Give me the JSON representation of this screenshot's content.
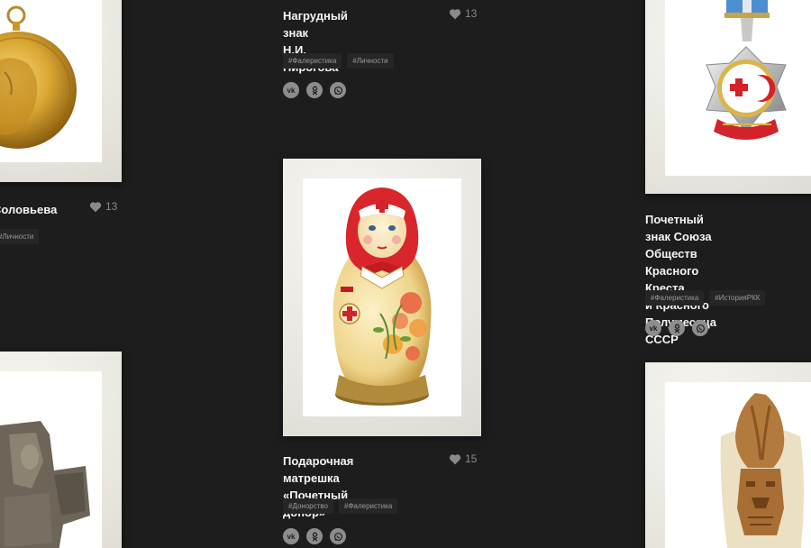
{
  "cards": {
    "pirogov": {
      "title": "Нагрудный знак\nН.И. Пирогова",
      "likes": "13",
      "tags": [
        "#Фалеристика",
        "#Личности"
      ]
    },
    "solovyev": {
      "title": "Соловьева",
      "likes": "13",
      "tags": [
        "#Личности"
      ]
    },
    "redcross": {
      "title": "Почетный знак Союза\nОбществ Красного Креста\nи Красного Полумесяца\nСССР",
      "tags": [
        "#Фалеристика",
        "#ИсторияРКК"
      ]
    },
    "matryoshka": {
      "title": "Подарочная матрешка\n«Почетный донор»",
      "likes": "15",
      "tags": [
        "#Донорство",
        "#Фалеристика"
      ]
    }
  },
  "icons": {
    "like": "heart-icon",
    "vk": "vk-icon",
    "ok": "odnoklassniki-icon",
    "whatsapp": "whatsapp-icon"
  },
  "colors": {
    "background": "#1d1d1d",
    "frame": "#ecebe6",
    "red_cross": "#d2232a",
    "icon_grey": "#8d8d8d"
  }
}
